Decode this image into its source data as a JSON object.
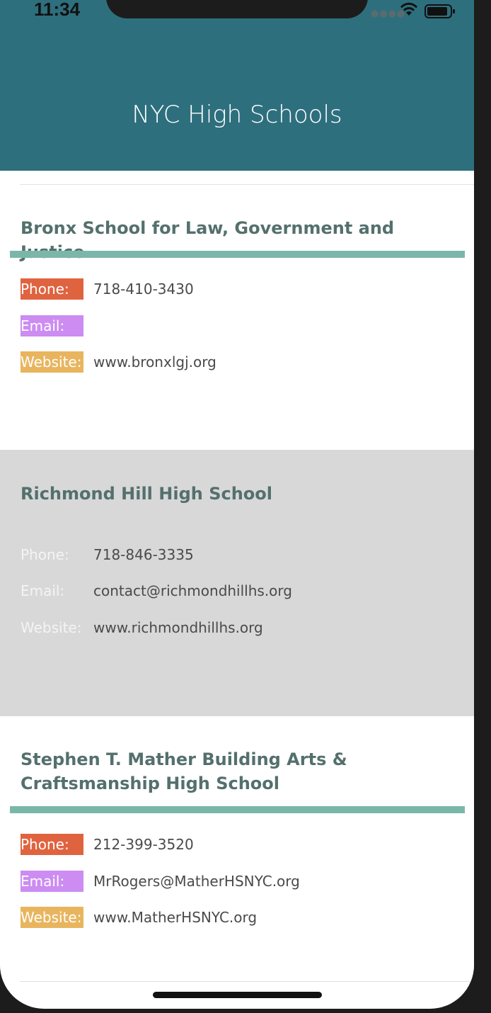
{
  "status_bar": {
    "time": "11:34"
  },
  "header": {
    "title": "NYC High Schools"
  },
  "labels": {
    "phone": "Phone:",
    "email": "Email:",
    "website": "Website:"
  },
  "schools": [
    {
      "name": "Bronx School for Law, Government and Justice",
      "phone": "718-410-3430",
      "email": "",
      "website": "www.bronxlgj.org"
    },
    {
      "name": "Richmond Hill High School",
      "phone": "718-846-3335",
      "email": "contact@richmondhillhs.org",
      "website": "www.richmondhillhs.org"
    },
    {
      "name": "Stephen T. Mather Building Arts & Craftsmanship High School",
      "phone": "212-399-3520",
      "email": "MrRogers@MatherHSNYC.org",
      "website": "www.MatherHSNYC.org"
    }
  ],
  "colors": {
    "header": "#2e6f7e",
    "school_name": "#54706d",
    "accent_line": "#7bb7a8",
    "phone_tag": "#e0633f",
    "email_tag": "#cc8cf2",
    "website_tag": "#e8b55e",
    "selected_row": "#d8d8d8"
  },
  "icons": [
    "cellular-signal-icon",
    "wifi-icon",
    "battery-icon"
  ]
}
